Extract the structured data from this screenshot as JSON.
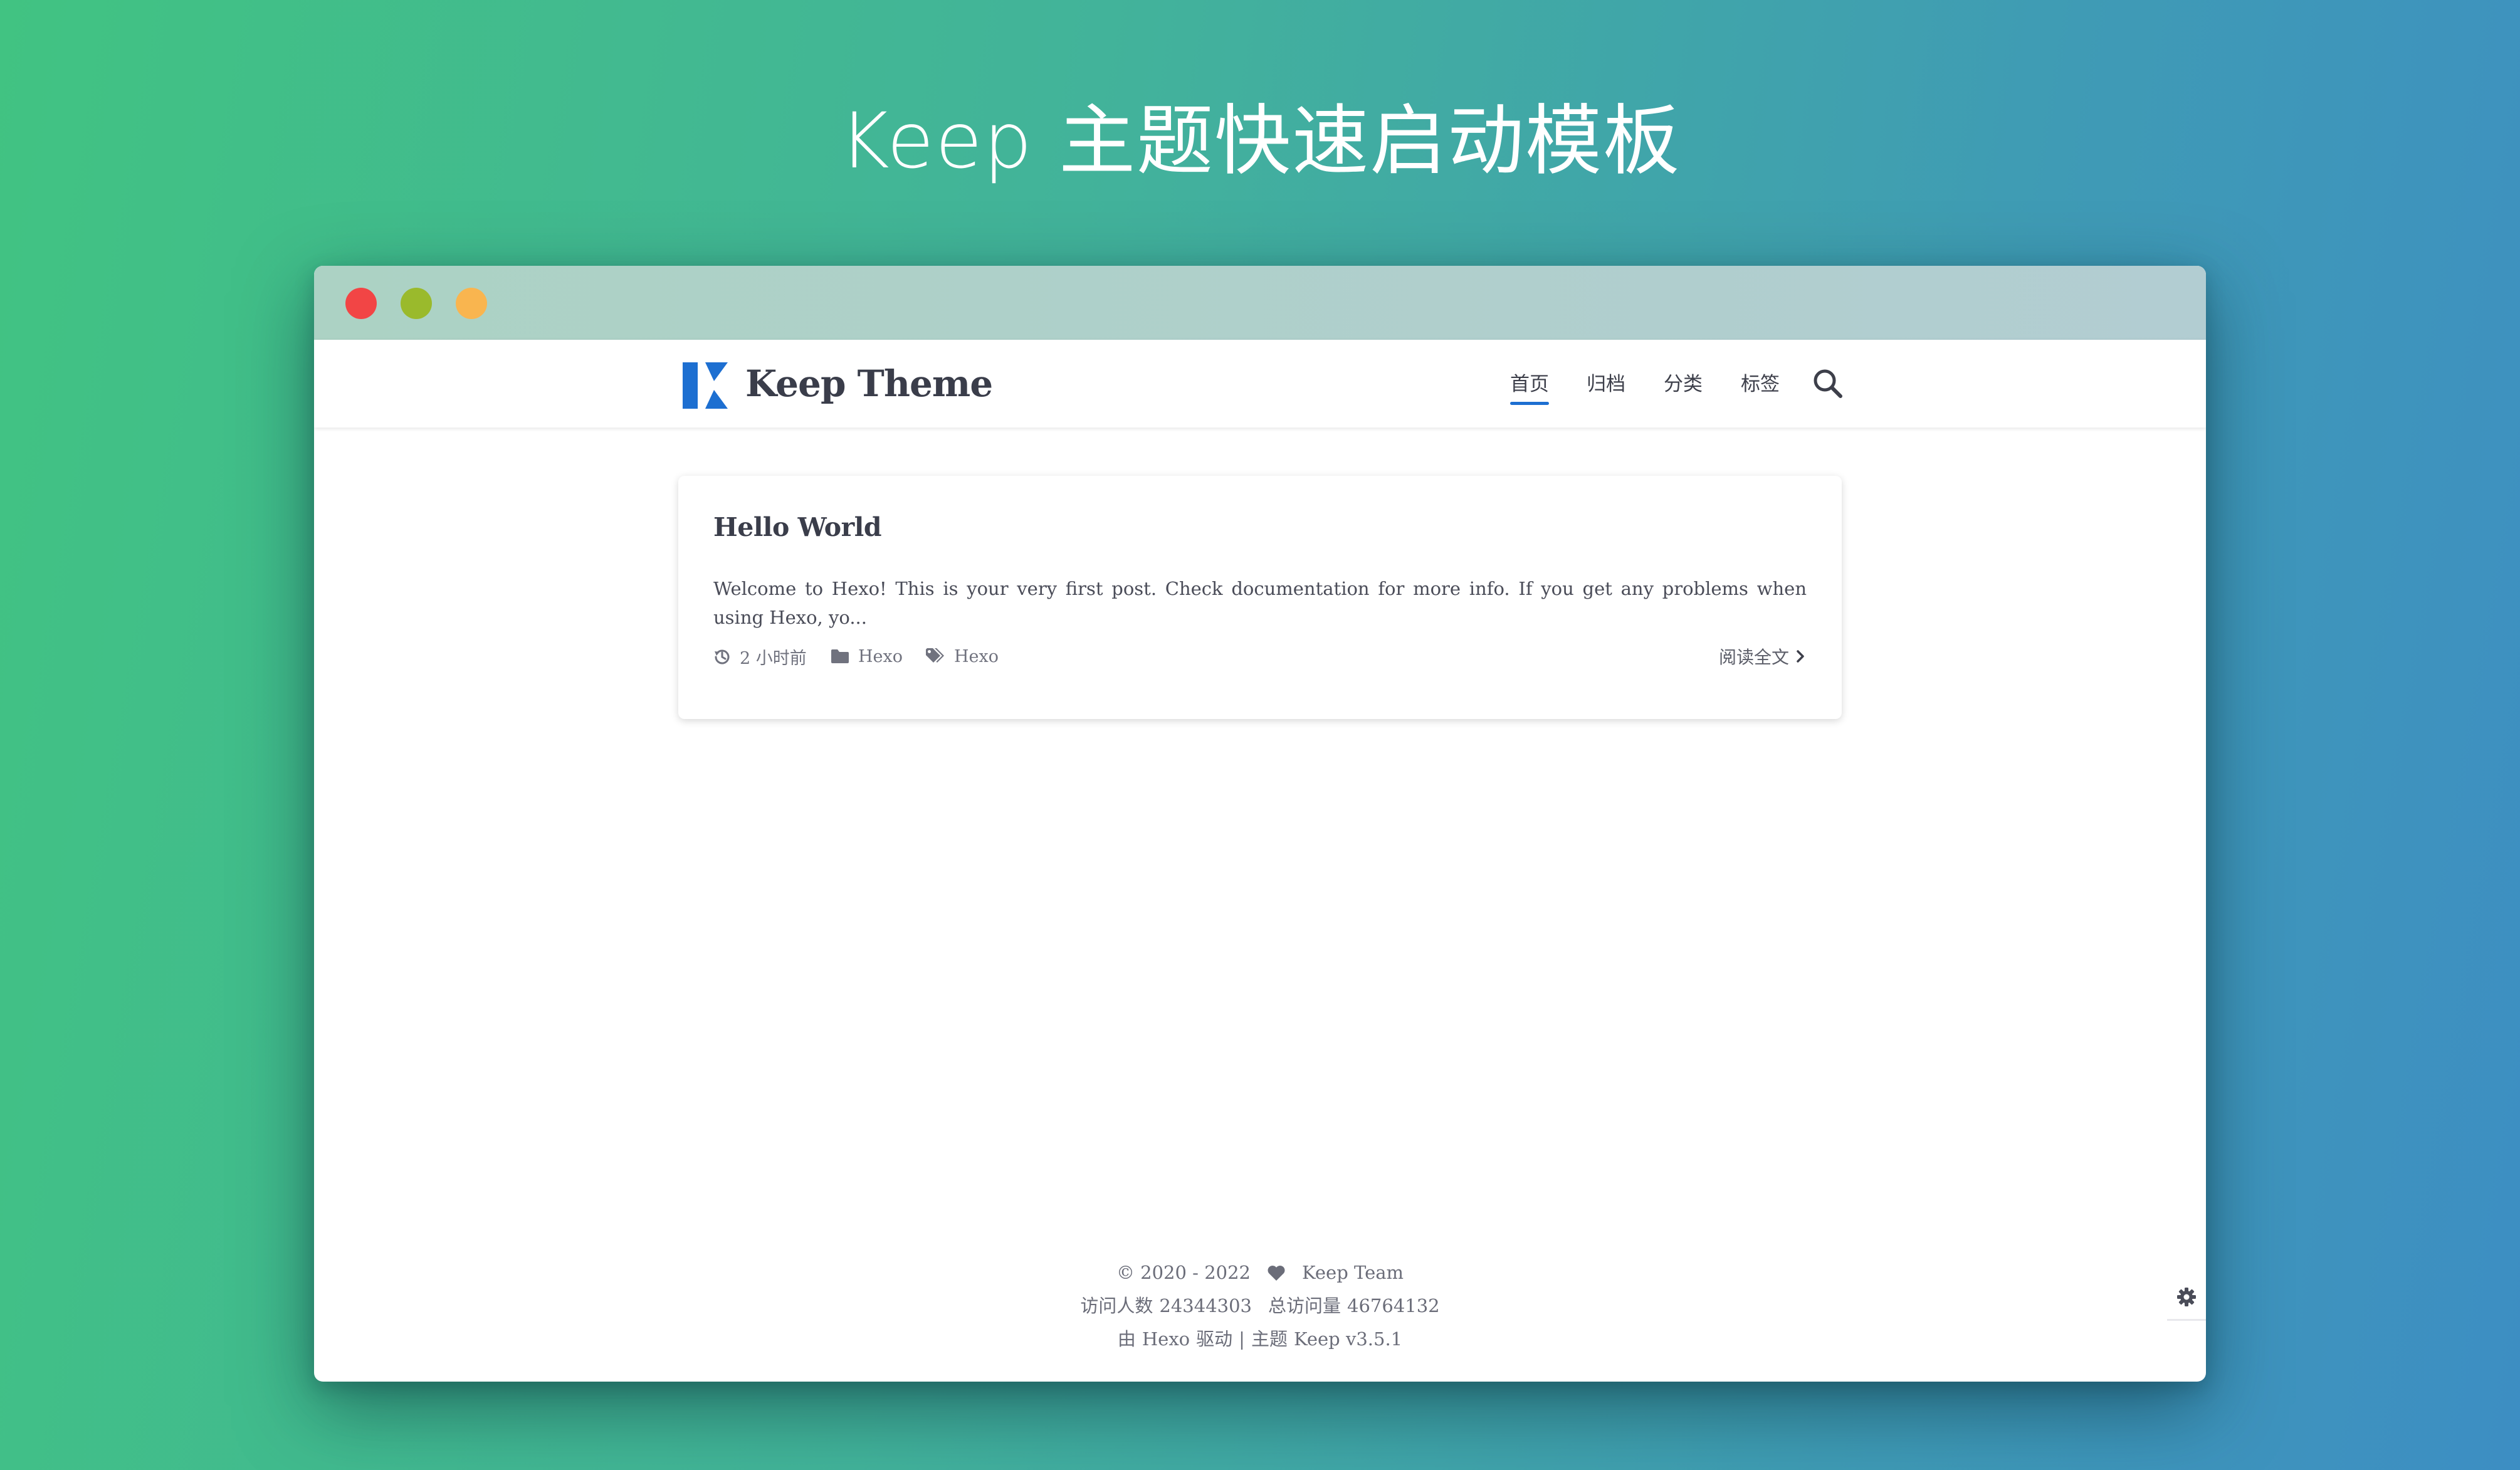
{
  "hero": {
    "title": "Keep 主题快速启动模板"
  },
  "colors": {
    "background_start": "#41c382",
    "background_end": "#3d8ec3",
    "window_close": "#f24545",
    "window_minimize": "#9aba2c",
    "window_zoom": "#f9b54f",
    "accent": "#1d6fd1",
    "text": "#3a3d4a"
  },
  "site": {
    "logo_icon": "keep-k-logo-icon",
    "name": "Keep Theme",
    "nav": [
      {
        "label": "首页",
        "active": true
      },
      {
        "label": "归档",
        "active": false
      },
      {
        "label": "分类",
        "active": false
      },
      {
        "label": "标签",
        "active": false
      }
    ],
    "search_icon": "search-icon"
  },
  "post": {
    "title": "Hello World",
    "excerpt": "Welcome to Hexo! This is your very first post. Check documentation for more info. If you get any problems when using Hexo, yo...",
    "time_icon": "history-icon",
    "time": "2 小时前",
    "category_icon": "folder-icon",
    "category": "Hexo",
    "tag_icon": "tags-icon",
    "tag": "Hexo",
    "read_more": "阅读全文"
  },
  "footer": {
    "copyright": "© 2020 - 2022",
    "heart_icon": "heart-icon",
    "team": "Keep Team",
    "visitors_label": "访问人数",
    "visitors": "24344303",
    "pageviews_label": "总访问量",
    "pageviews": "46764132",
    "powered_prefix": "由",
    "powered_by": "Hexo",
    "powered_suffix": "驱动",
    "separator": "|",
    "theme_prefix": "主题",
    "theme_name": "Keep v3.5.1"
  },
  "tools": {
    "settings_icon": "gear-icon"
  }
}
